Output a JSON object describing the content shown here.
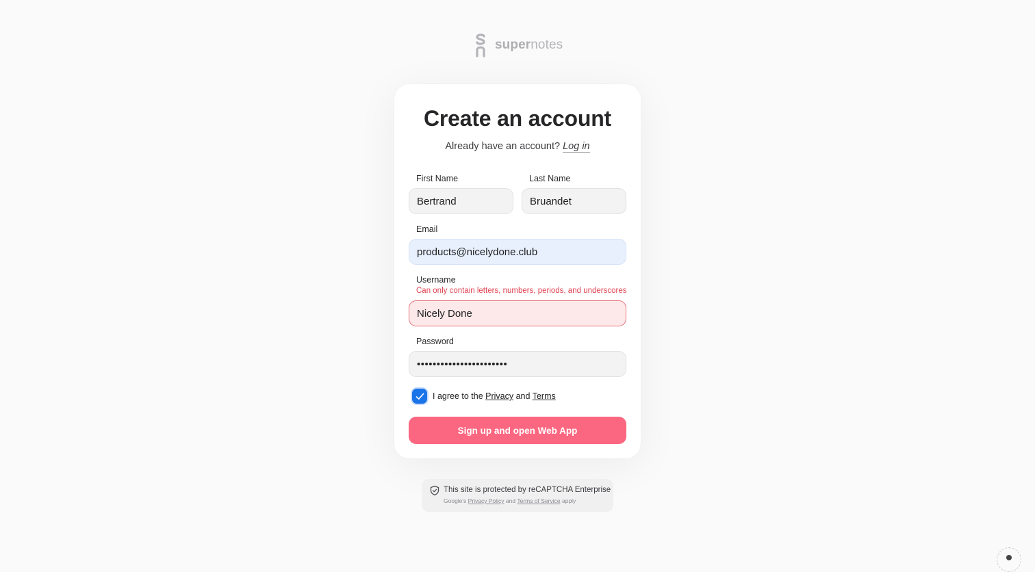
{
  "brand": {
    "name_bold": "super",
    "name_rest": "notes",
    "icon": "supernotes-logo-icon"
  },
  "form": {
    "title": "Create an account",
    "subtitle_text": "Already have an account? ",
    "login_link": "Log in",
    "first_name": {
      "label": "First Name",
      "value": "Bertrand"
    },
    "last_name": {
      "label": "Last Name",
      "value": "Bruandet"
    },
    "email": {
      "label": "Email",
      "value": "products@nicelydone.club"
    },
    "username": {
      "label": "Username",
      "error": "Can only contain letters, numbers, periods, and underscores",
      "value": "Nicely Done"
    },
    "password": {
      "label": "Password",
      "value": "•••••••••••••••••••••••"
    },
    "agree": {
      "checked": true,
      "prefix": "I agree to the ",
      "privacy": "Privacy",
      "and": " and ",
      "terms": "Terms"
    },
    "submit_label": "Sign up and open Web App"
  },
  "recaptcha": {
    "line1": "This site is protected by reCAPTCHA Enterprise",
    "line2_prefix": "Google's ",
    "privacy_policy": "Privacy Policy",
    "and": " and ",
    "terms_of_service": "Terms of Service",
    "line2_suffix": " apply"
  },
  "colors": {
    "accent_button": "#fb6780",
    "error": "#e0414f",
    "checkbox": "#1a73e8",
    "email_autofill": "#e8f0fe",
    "invalid_field": "#fde9e9"
  }
}
